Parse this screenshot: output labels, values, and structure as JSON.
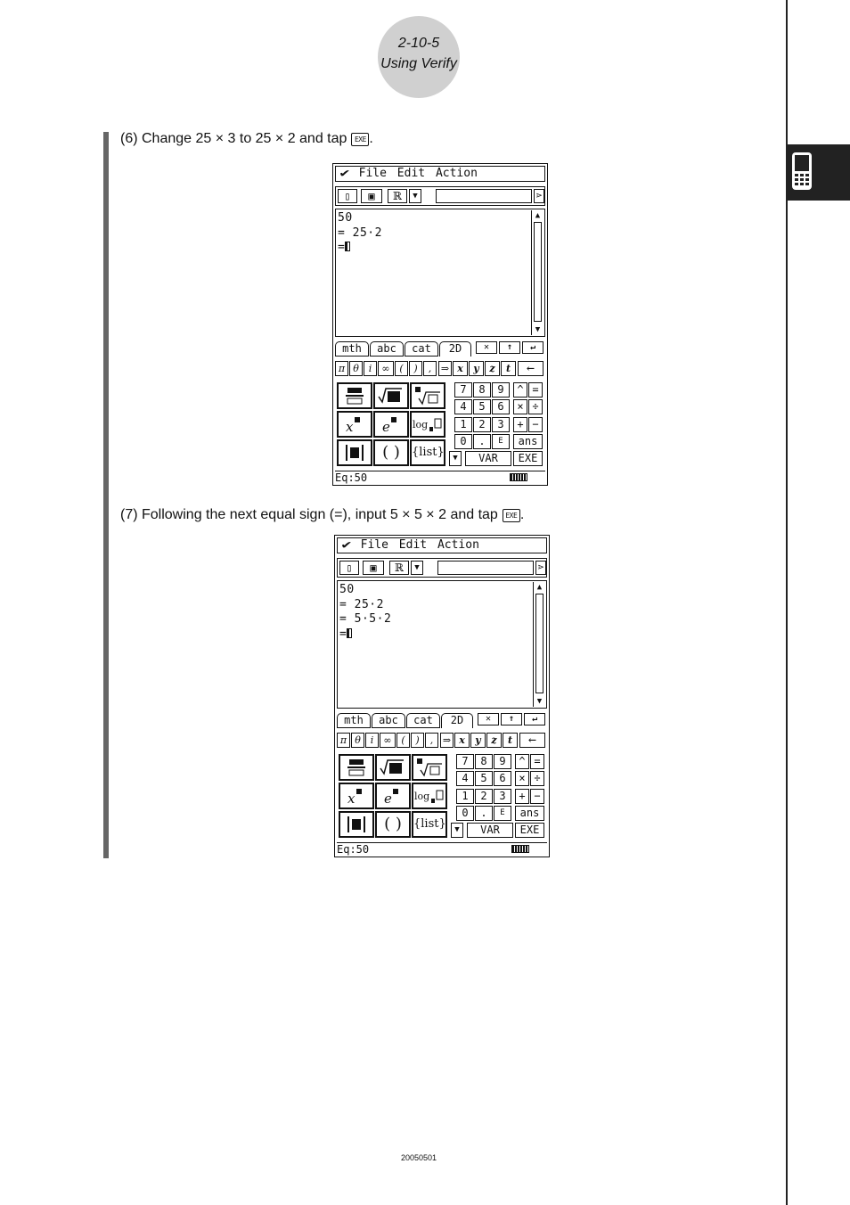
{
  "header": {
    "page_number": "2-10-5",
    "section_title": "Using Verify"
  },
  "steps": [
    {
      "text": "(6) Change 25 × 3 to 25 × 2 and tap",
      "key": "EXE"
    },
    {
      "text": "(7) Following the next equal sign (=), input 5 × 5 × 2 and tap",
      "key": "EXE"
    }
  ],
  "screens": [
    {
      "menu": [
        "File",
        "Edit",
        "Action"
      ],
      "lines": [
        "50",
        "= 25·2",
        "="
      ],
      "status": "Eq:50"
    },
    {
      "menu": [
        "File",
        "Edit",
        "Action"
      ],
      "lines": [
        "50",
        "= 25·2",
        "= 5·5·2",
        "="
      ],
      "status": "Eq:50"
    }
  ],
  "keyboard": {
    "tabs": [
      "mth",
      "abc",
      "cat",
      "2D"
    ],
    "symbols": [
      "π",
      "θ",
      "i",
      "∞",
      "(",
      ")",
      ",",
      "⇒",
      "x",
      "y",
      "z",
      "t",
      "←"
    ],
    "digits": [
      "7",
      "8",
      "9",
      "4",
      "5",
      "6",
      "1",
      "2",
      "3",
      "0",
      ".",
      "E"
    ],
    "ops": [
      "^",
      "=",
      "×",
      "÷",
      "+",
      "−"
    ],
    "ans": "ans",
    "var": "VAR",
    "exe": "EXE",
    "templates": [
      "frac",
      "√■",
      "ⁿ√□",
      "x■",
      "e■",
      "log■□",
      "|■|",
      "( )",
      "{list}"
    ]
  },
  "footer": {
    "code": "20050501"
  }
}
